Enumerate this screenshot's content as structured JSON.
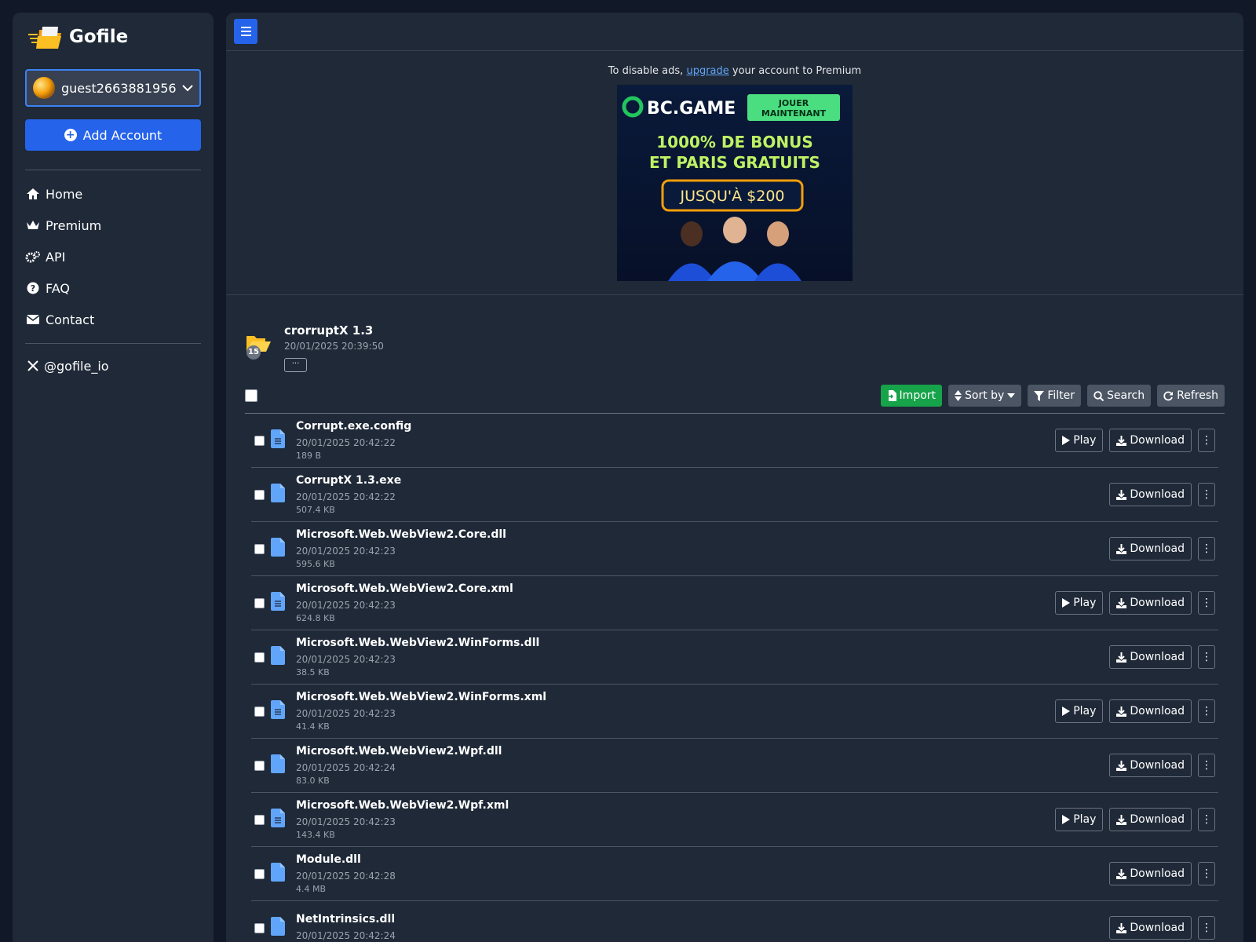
{
  "brand": {
    "name": "Gofile"
  },
  "account": {
    "username": "guest2663881956"
  },
  "add_account_label": "Add Account",
  "nav": [
    {
      "label": "Home",
      "icon": "home-icon"
    },
    {
      "label": "Premium",
      "icon": "crown-icon"
    },
    {
      "label": "API",
      "icon": "gears-icon"
    },
    {
      "label": "FAQ",
      "icon": "question-icon"
    },
    {
      "label": "Contact",
      "icon": "envelope-icon"
    }
  ],
  "social": {
    "label": "@gofile_io",
    "icon": "x-logo-icon"
  },
  "ad": {
    "note_before": "To disable ads,",
    "note_link": "upgrade",
    "note_after": "your account to Premium",
    "banner_text": [
      "BC.GAME",
      "JOUER MAINTENANT",
      "1000% DE BONUS",
      "ET PARIS GRATUITS",
      "JUSQU'À $200"
    ]
  },
  "folder": {
    "name": "crorruptX 1.3",
    "date": "20/01/2025 20:39:50",
    "count": "15",
    "more": "···"
  },
  "toolbar": {
    "import": "Import",
    "sort": "Sort by",
    "filter": "Filter",
    "search": "Search",
    "refresh": "Refresh"
  },
  "actions": {
    "play": "Play",
    "download": "Download"
  },
  "files": [
    {
      "name": "Corrupt.exe.config",
      "date": "20/01/2025 20:42:22",
      "size": "189 B",
      "text": true,
      "play": true
    },
    {
      "name": "CorruptX 1.3.exe",
      "date": "20/01/2025 20:42:22",
      "size": "507.4 KB",
      "text": false,
      "play": false
    },
    {
      "name": "Microsoft.Web.WebView2.Core.dll",
      "date": "20/01/2025 20:42:23",
      "size": "595.6 KB",
      "text": false,
      "play": false
    },
    {
      "name": "Microsoft.Web.WebView2.Core.xml",
      "date": "20/01/2025 20:42:23",
      "size": "624.8 KB",
      "text": true,
      "play": true
    },
    {
      "name": "Microsoft.Web.WebView2.WinForms.dll",
      "date": "20/01/2025 20:42:23",
      "size": "38.5 KB",
      "text": false,
      "play": false
    },
    {
      "name": "Microsoft.Web.WebView2.WinForms.xml",
      "date": "20/01/2025 20:42:23",
      "size": "41.4 KB",
      "text": true,
      "play": true
    },
    {
      "name": "Microsoft.Web.WebView2.Wpf.dll",
      "date": "20/01/2025 20:42:24",
      "size": "83.0 KB",
      "text": false,
      "play": false
    },
    {
      "name": "Microsoft.Web.WebView2.Wpf.xml",
      "date": "20/01/2025 20:42:23",
      "size": "143.4 KB",
      "text": true,
      "play": true
    },
    {
      "name": "Module.dll",
      "date": "20/01/2025 20:42:28",
      "size": "4.4 MB",
      "text": false,
      "play": false
    },
    {
      "name": "NetIntrinsics.dll",
      "date": "20/01/2025 20:42:24",
      "size": "",
      "text": false,
      "play": false
    }
  ],
  "colors": {
    "accent": "#2563eb",
    "import": "#16a34a",
    "file_icon": "#60a5fa",
    "folder_icon": "#fbbf24"
  }
}
